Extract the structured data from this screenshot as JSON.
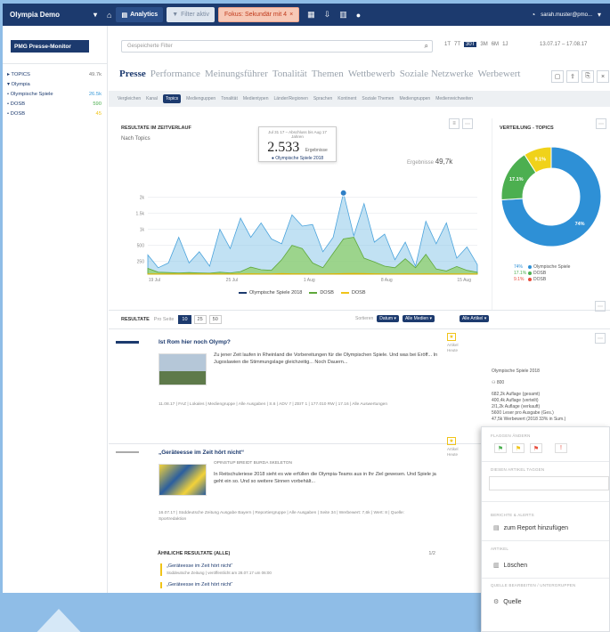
{
  "topbar": {
    "project": "Olympia Demo",
    "analytics": "Analytics",
    "filter": "Filter aktiv",
    "warning": "Fokus: Sekundär mit 4",
    "user": "sarah.muster@pmo..."
  },
  "sidebar": {
    "logo": "PMG Presse-Monitor",
    "items": [
      {
        "label": "▸ TOPICS",
        "count": "49.7k",
        "color": ""
      },
      {
        "label": "▾ Olympia",
        "count": "",
        "color": ""
      },
      {
        "label": "  • Olympische Spiele",
        "count": "26.5k",
        "color": "blue"
      },
      {
        "label": "  • DOSB",
        "count": "590",
        "color": "green"
      },
      {
        "label": "  • DOSB",
        "count": "45",
        "color": "yellow"
      }
    ]
  },
  "toolbar": {
    "search_placeholder": "Gespeicherte Filter",
    "ranges": [
      "1T",
      "7T",
      "30T",
      "3M",
      "6M",
      "1J"
    ],
    "active_range": "30T",
    "dates": "13.07.17 – 17.08.17"
  },
  "pills": [
    "Presse",
    "Performance",
    "Meinungsführer",
    "Tonalität",
    "Themen",
    "Wettbewerb",
    "Soziale Netzwerke",
    "Werbewert"
  ],
  "subtabs": [
    "Vergleichen",
    "Kanal",
    "Topics",
    "Medienguppen",
    "Tonalität",
    "Medientypen",
    "Länder/Regionen",
    "Sprachen",
    "Kontinent",
    "Soziale Themen",
    "Mediengruppen",
    "Medienreichweiten"
  ],
  "subtab_active": "Topics",
  "chart": {
    "title": "RESULTATE IM ZEITVERLAUF",
    "subtitle": "Nach Topics",
    "tooltip_date": "Jul 31 17 – Abschluss bis Aug 17 Jahren",
    "tooltip_value": "2.533",
    "tooltip_unit": "Ergebnisse",
    "tooltip_series": "● Olympische Spiele 2018",
    "results_label": "Ergebnisse",
    "results_value": "49,7k"
  },
  "chart_data": {
    "type": "area",
    "title": "RESULTATE IM ZEITVERLAUF",
    "yticks": [
      "2k",
      "1.5k",
      "1k",
      "500",
      "250"
    ],
    "xticks": [
      "19 Jul",
      "25 Jul",
      "1 Aug",
      "8 Aug",
      "15 Aug"
    ],
    "ylim": [
      0,
      3000
    ],
    "series": [
      {
        "name": "Olympische Spiele 2018",
        "color": "#8ec9ea",
        "values": [
          600,
          200,
          350,
          1150,
          350,
          700,
          250,
          1400,
          800,
          1750,
          1150,
          1600,
          1100,
          950,
          1850,
          1500,
          1550,
          700,
          1150,
          2533,
          1200,
          2200,
          1000,
          1250,
          450,
          1000,
          250,
          1650,
          950,
          1600,
          500,
          850,
          300
        ]
      },
      {
        "name": "DOSB",
        "color": "#8fcf6a",
        "values": [
          180,
          60,
          50,
          40,
          50,
          40,
          30,
          60,
          40,
          80,
          220,
          140,
          120,
          450,
          900,
          800,
          350,
          200,
          650,
          1100,
          1150,
          500,
          380,
          250,
          200,
          480,
          200,
          620,
          160,
          100,
          240,
          120,
          60
        ]
      },
      {
        "name": "DOSB",
        "color": "#f0c419",
        "values": [
          10,
          10,
          10,
          10,
          10,
          10,
          10,
          10,
          10,
          10,
          15,
          10,
          10,
          20,
          15,
          15,
          10,
          10,
          15,
          20,
          25,
          20,
          15,
          10,
          10,
          15,
          10,
          15,
          10,
          10,
          10,
          10,
          10
        ]
      }
    ]
  },
  "donut": {
    "title": "VERTEILUNG - TOPICS",
    "slices": [
      {
        "name": "Olympische Spiele 2018",
        "value": 74,
        "color": "#2e90d6",
        "label": "74%"
      },
      {
        "name": "DOSB",
        "value": 17,
        "color": "#4caf50",
        "label": "17.1%"
      },
      {
        "name": "DOSB",
        "value": 9,
        "color": "#f0d21a",
        "label": "9.1%"
      }
    ],
    "legend": [
      {
        "pct": "74%",
        "name": "Olympische Spiele",
        "color": "#2e90d6"
      },
      {
        "pct": "17.1%",
        "name": "DOSB",
        "color": "#4caf50"
      },
      {
        "pct": "9.1%",
        "name": "DOSB",
        "color": "#e74c3c"
      }
    ]
  },
  "results": {
    "label": "RESULTATE",
    "per_page": "Pro Seite",
    "pages": [
      "10",
      "25",
      "50"
    ],
    "active_page": "10",
    "sort_label": "Sortieren",
    "chip1": "Datum ▾",
    "chip2": "Alle Medien ▾",
    "chip3": "Alle Artikel ▾",
    "articles": [
      {
        "title": "Ist Rom hier noch Olymp?",
        "text": "Zu jener Zeit laufen in Rheinland die Vorbereitungen für die Olympischen Spiele. Und was bei Eröff... In Jugoslawien die Stimmungslage gleichzeitig... Noch Dauern...",
        "meta": "11.08.17 | FAZ | Lokales | Mediengruppe | Alle Ausgaben | S.6 | ADV 7 | ZEIT 1 | 177.010 RW | 17.16 | Alle Auswertungen",
        "side1": "Artikel",
        "side2": "Heute"
      },
      {
        "title": "„Geräteesse im Zeit hört nicht“",
        "sub": "OPINSTUP BREIDT BURDA SKELETON",
        "text": "In Reitschuleriese 2018 sieht es wie erfüllen die Olympia-Teams aus in Ihr Ziel gewesen. Und Spiele ja geht ein so. Und so weitere Sinnen vorbehält...",
        "meta": "16.07.17 | Süddeutsche Zeitung Ausgabe Bayern | Reportiergruppe | Alle Ausgaben | Seite 34 | Werbewert: 7,6k | Wert: 8 | Quelle: Sportredaktion",
        "side1": "Artikel",
        "side2": "Heute"
      }
    ],
    "related_header": "ÄHNLICHE RESULTATE (ALLE)",
    "related_count": "1/2",
    "related": [
      {
        "title": "„Geräteesse im Zeit hört nicht“",
        "meta": "Süddeutsche Zeitung | veröffentlicht am 28.07.17 um 06:00"
      },
      {
        "title": "„Geräteesse im Zeit hört nicht“",
        "meta": ""
      }
    ]
  },
  "detail": {
    "topic": "Olympische Spiele 2018",
    "count": "800",
    "lines": [
      "682,2k Auflage (gesamt)",
      "400,4k Auflage (verteilt)",
      "2/1,2k Auflage (verkauft)",
      "5600 Leser pro Ausgabe (Ges.)",
      "47,5k Werbewert (2018 33% in Sum.)"
    ]
  },
  "popup": {
    "flag_header": "FLAGGEN ÄNDERN",
    "tag_header": "DIESEN ARTIKEL TAGGEN",
    "report_header": "BERICHTE & ALERTS",
    "report_label": "zum Report hinzufügen",
    "delete_header": "ARTIKEL",
    "delete_label": "Löschen",
    "source_header": "QUELLE BEARBEITEN / UNTERGRUPPEN",
    "source_label": "Quelle"
  }
}
